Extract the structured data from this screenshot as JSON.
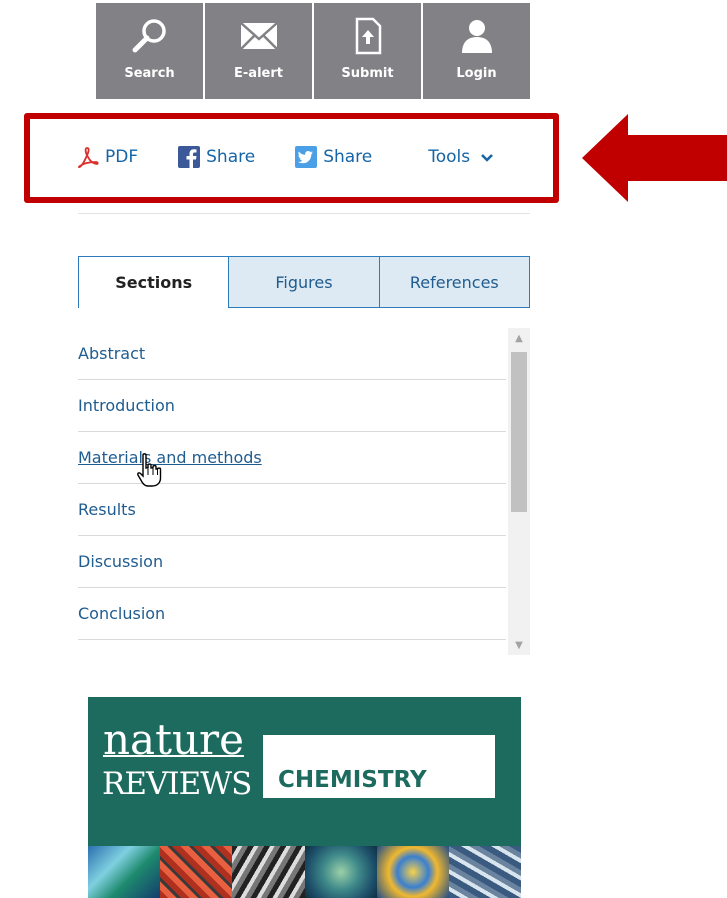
{
  "toolbar": {
    "buttons": [
      {
        "label": "Search",
        "icon": "search-icon"
      },
      {
        "label": "E-alert",
        "icon": "envelope-icon"
      },
      {
        "label": "Submit",
        "icon": "upload-document-icon"
      },
      {
        "label": "Login",
        "icon": "user-icon"
      }
    ]
  },
  "share": {
    "pdf_label": "PDF",
    "facebook_label": "Share",
    "twitter_label": "Share",
    "tools_label": "Tools"
  },
  "tabs": [
    {
      "label": "Sections",
      "active": true
    },
    {
      "label": "Figures",
      "active": false
    },
    {
      "label": "References",
      "active": false
    }
  ],
  "sections": [
    "Abstract",
    "Introduction",
    "Materials and methods",
    "Results",
    "Discussion",
    "Conclusion"
  ],
  "ad": {
    "brand_word_1": "nature",
    "brand_word_2": "REVIEWS",
    "journal": "CHEMISTRY"
  },
  "colors": {
    "toolbar_bg": "#828186",
    "highlight": "#c00000",
    "link": "#1f5c8f",
    "ad_bg": "#1d6b5e"
  }
}
